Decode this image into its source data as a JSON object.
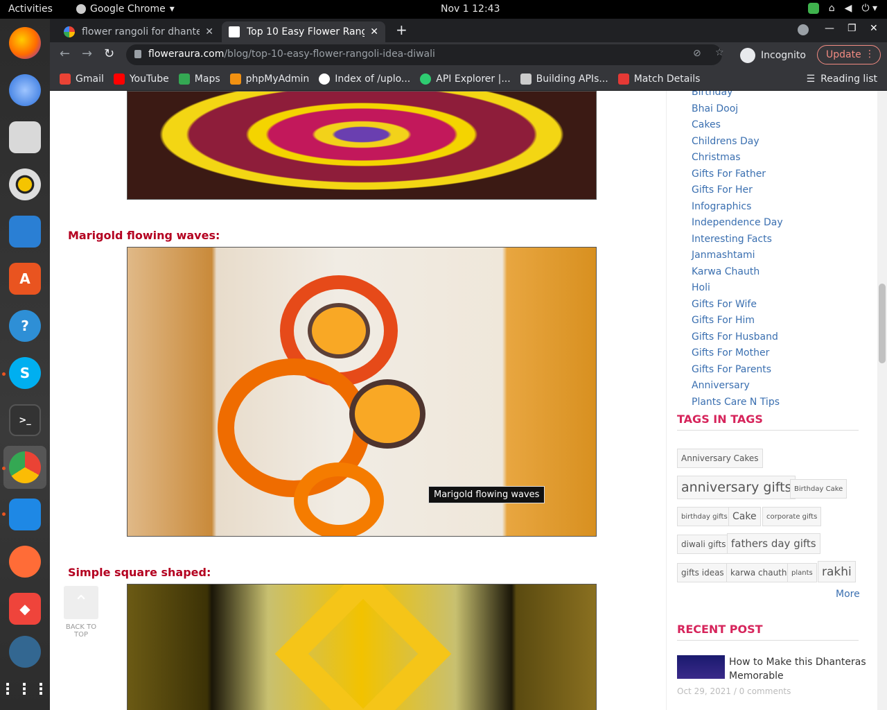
{
  "topbar": {
    "activities": "Activities",
    "app_name": "Google Chrome",
    "clock": "Nov 1  12:43"
  },
  "tabs": [
    {
      "title": "flower rangoli for dhante",
      "active": false
    },
    {
      "title": "Top 10 Easy Flower Rango",
      "active": true
    }
  ],
  "omnibox": {
    "host": "floweraura.com",
    "path": "/blog/top-10-easy-flower-rangoli-idea-diwali"
  },
  "incognito_label": "Incognito",
  "update_label": "Update",
  "bookmarks": [
    {
      "label": "Gmail",
      "color": "#ea4335"
    },
    {
      "label": "YouTube",
      "color": "#ff0000"
    },
    {
      "label": "Maps",
      "color": "#34a853"
    },
    {
      "label": "phpMyAdmin",
      "color": "#f29111"
    },
    {
      "label": "Index of /uplo...",
      "color": "#ffffff"
    },
    {
      "label": "API Explorer |...",
      "color": "#2ecc71"
    },
    {
      "label": "Building APIs...",
      "color": "#cccccc"
    },
    {
      "label": "Match Details",
      "color": "#e53935"
    }
  ],
  "reading_list": "Reading list",
  "article": {
    "section1_title": "Marigold flowing waves:",
    "section2_title": "Simple square shaped:",
    "tooltip": "Marigold flowing waves",
    "back_to_top": "BACK TO TOP"
  },
  "categories": [
    "Birthday",
    "Bhai Dooj",
    "Cakes",
    "Childrens Day",
    "Christmas",
    "Gifts For Father",
    "Gifts For Her",
    "Infographics",
    "Independence Day",
    "Interesting Facts",
    "Janmashtami",
    "Karwa Chauth",
    "Holi",
    "Gifts For Wife",
    "Gifts For Him",
    "Gifts For Husband",
    "Gifts For Mother",
    "Gifts For Parents",
    "Anniversary",
    "Plants Care N Tips"
  ],
  "tags_heading": "TAGS IN TAGS",
  "tags": [
    "Anniversary Cakes",
    "anniversary gifts",
    "Birthday Cake",
    "birthday gifts",
    "Cake",
    "corporate gifts",
    "diwali gifts",
    "fathers day gifts",
    "gifts ideas",
    "karwa chauth",
    "plants",
    "rakhi"
  ],
  "tags_more": "More",
  "recent_heading": "RECENT POST",
  "recent_post": {
    "title": "How to Make this Dhanteras Memorable",
    "meta": "Oct 29, 2021 / 0 comments"
  }
}
